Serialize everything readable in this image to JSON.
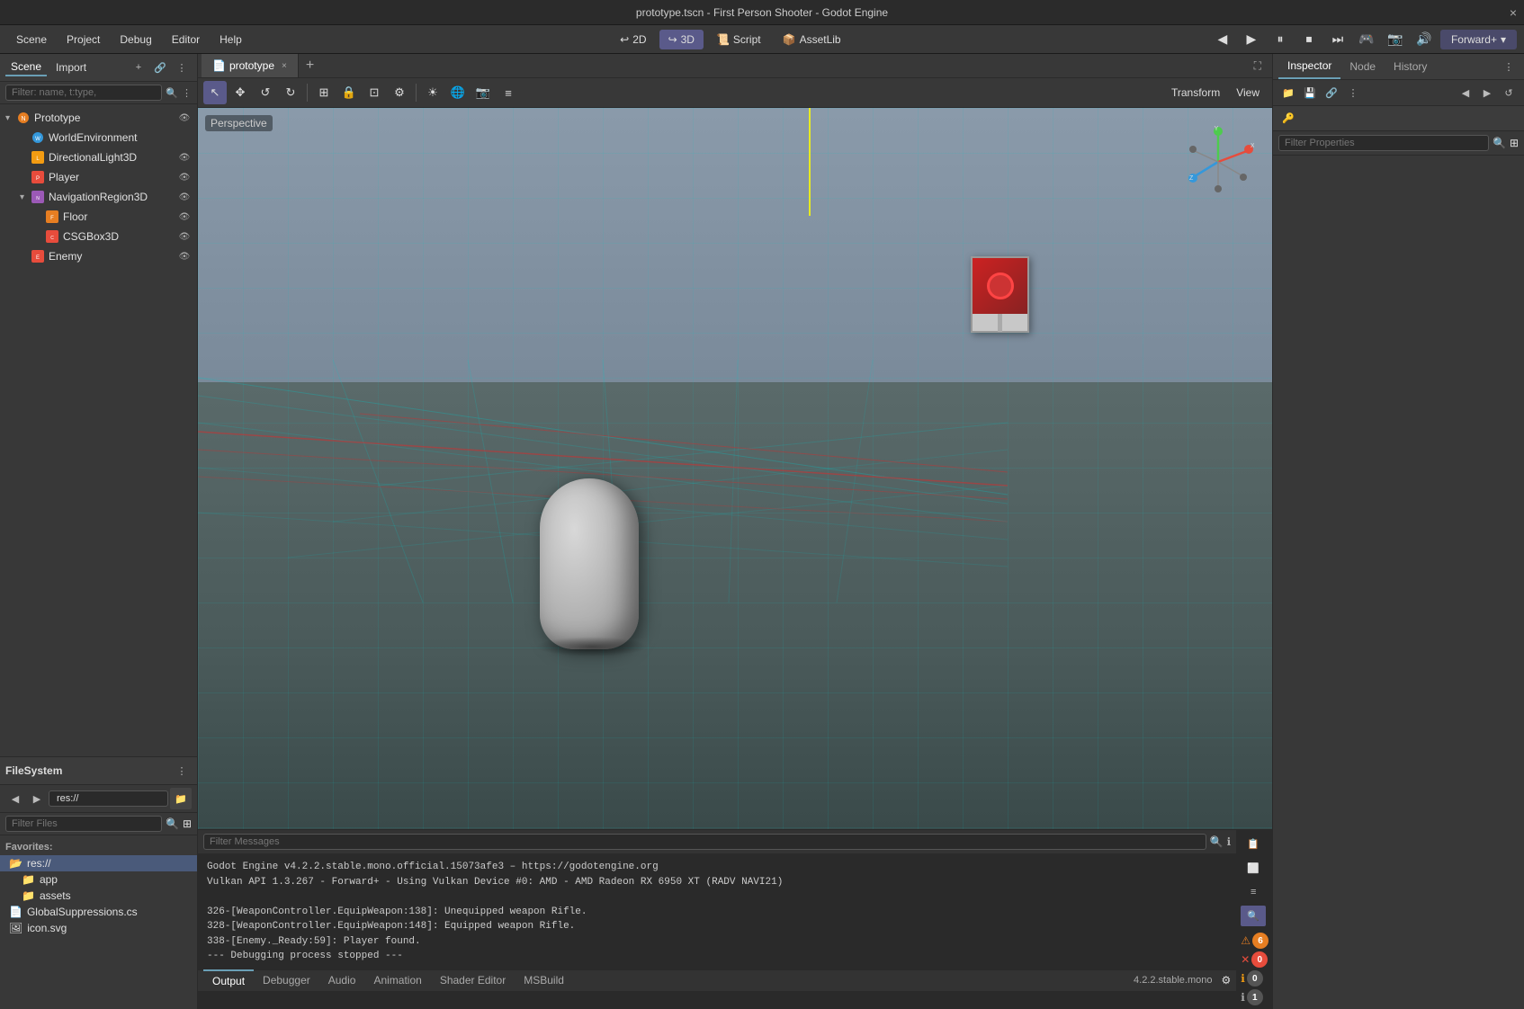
{
  "window": {
    "title": "prototype.tscn - First Person Shooter - Godot Engine",
    "close_icon": "×"
  },
  "menu": {
    "items": [
      "Scene",
      "Project",
      "Debug",
      "Editor",
      "Help"
    ],
    "center_items": [
      {
        "label": "2D",
        "icon": "↩",
        "active": false
      },
      {
        "label": "3D",
        "icon": "↪",
        "active": true
      },
      {
        "label": "Script",
        "icon": "📜",
        "active": false
      },
      {
        "label": "AssetLib",
        "icon": "📦",
        "active": false
      }
    ],
    "right_items": [
      "◀",
      "▶",
      "⏸",
      "⏹",
      "⏮",
      "🎮",
      "📷",
      "🔊"
    ],
    "forward_plus": "Forward+"
  },
  "scene_panel": {
    "tab_scene": "Scene",
    "tab_import": "Import",
    "filter_placeholder": "Filter: name, t:type,",
    "tree": [
      {
        "id": "prototype",
        "label": "Prototype",
        "level": 0,
        "type": "node3d",
        "arrow": "▾",
        "color": "#e67e22",
        "vis": true
      },
      {
        "id": "world-env",
        "label": "WorldEnvironment",
        "level": 1,
        "type": "world",
        "arrow": "",
        "color": "#3498db",
        "vis": true
      },
      {
        "id": "dir-light",
        "label": "DirectionalLight3D",
        "level": 1,
        "type": "light",
        "arrow": "",
        "color": "#f39c12",
        "vis": true,
        "has_vis_toggle": true
      },
      {
        "id": "player",
        "label": "Player",
        "level": 1,
        "type": "player",
        "arrow": "",
        "color": "#e74c3c",
        "vis": true,
        "has_actions": true
      },
      {
        "id": "nav-region",
        "label": "NavigationRegion3D",
        "level": 1,
        "type": "nav",
        "arrow": "▾",
        "color": "#9b59b6",
        "vis": true
      },
      {
        "id": "floor",
        "label": "Floor",
        "level": 2,
        "type": "floor",
        "arrow": "",
        "color": "#e67e22",
        "vis": true
      },
      {
        "id": "csgbox",
        "label": "CSGBox3D",
        "level": 2,
        "type": "csg",
        "arrow": "",
        "color": "#e74c3c",
        "vis": true
      },
      {
        "id": "enemy",
        "label": "Enemy",
        "level": 1,
        "type": "enemy",
        "arrow": "",
        "color": "#e74c3c",
        "vis": true,
        "has_actions": true
      }
    ]
  },
  "filesystem": {
    "title": "FileSystem",
    "path": "res://",
    "filter_placeholder": "Filter Files",
    "favorites_label": "Favorites:",
    "items": [
      {
        "label": "res://",
        "type": "folder",
        "selected": true,
        "level": 0
      },
      {
        "label": "app",
        "type": "folder",
        "selected": false,
        "level": 1
      },
      {
        "label": "assets",
        "type": "folder",
        "selected": false,
        "level": 1
      },
      {
        "label": "GlobalSuppressions.cs",
        "type": "script",
        "selected": false,
        "level": 0
      },
      {
        "label": "icon.svg",
        "type": "image",
        "selected": false,
        "level": 0
      }
    ]
  },
  "tabs": [
    {
      "label": "prototype",
      "active": true
    }
  ],
  "viewport": {
    "perspective_label": "Perspective",
    "toolbar_items": [
      "↖",
      "✥",
      "↺",
      "↻",
      "⊞",
      "🔒",
      "⊡",
      "⚙",
      "◉",
      "⚡",
      "📷",
      "≡"
    ],
    "transform_label": "Transform",
    "view_label": "View"
  },
  "console": {
    "filter_placeholder": "Filter Messages",
    "log_lines": [
      "Godot Engine v4.2.2.stable.mono.official.15073afe3 – https://godotengine.org",
      "Vulkan API 1.3.267 - Forward+ - Using Vulkan Device #0: AMD - AMD Radeon RX 6950 XT (RADV NAVI21)",
      "",
      "326-[WeaponController.EquipWeapon:138]: Unequipped weapon Rifle.",
      "328-[WeaponController.EquipWeapon:148]: Equipped weapon Rifle.",
      "338-[Enemy._Ready:59]: Player found.",
      "--- Debugging process stopped ---"
    ],
    "tabs": [
      "Output",
      "Debugger",
      "Audio",
      "Animation",
      "Shader Editor",
      "MSBuild"
    ],
    "version": "4.2.2.stable.mono",
    "badge_warn": "6",
    "badge_err": "0",
    "badge_info": "0",
    "badge_msg": "1"
  },
  "inspector": {
    "tab_inspector": "Inspector",
    "tab_node": "Node",
    "tab_history": "History",
    "filter_placeholder": "Filter Properties"
  }
}
